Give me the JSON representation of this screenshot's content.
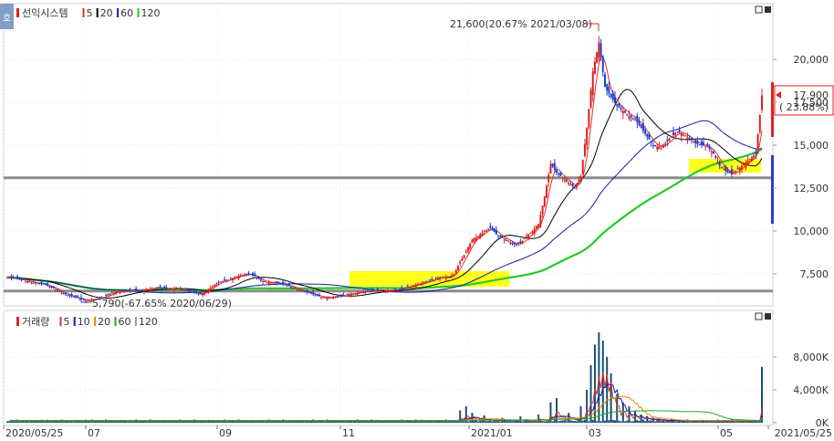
{
  "header": {
    "side_badge": "호",
    "price_title": "선익시스템",
    "price_ma": [
      {
        "label": "5",
        "color": "#e03030"
      },
      {
        "label": "20",
        "color": "#000000"
      },
      {
        "label": "60",
        "color": "#1a1aa8"
      },
      {
        "label": "120",
        "color": "#22cc22"
      }
    ],
    "volume_title": "거래량",
    "volume_ma": [
      {
        "label": "5",
        "color": "#e03030"
      },
      {
        "label": "10",
        "color": "#1a1aa8"
      },
      {
        "label": "20",
        "color": "#e08a00"
      },
      {
        "label": "60",
        "color": "#22aa22"
      },
      {
        "label": "120",
        "color": "#999999"
      }
    ]
  },
  "chart_data": {
    "type": "candlestick",
    "x_ticks": [
      "2020/05/25",
      "07",
      "09",
      "11",
      "2021/01",
      "03",
      "05",
      "2021/05/25"
    ],
    "price_axis": {
      "ticks": [
        "20,000",
        "17,500",
        "15,000",
        "12,500",
        "10,000",
        "7,500"
      ],
      "range": [
        5900,
        22400
      ]
    },
    "volume_axis": {
      "ticks": [
        "8,000K",
        "4,000K",
        "0K"
      ],
      "range": [
        0,
        12000
      ]
    },
    "annotations": {
      "high": "21,600(20.67% 2021/03/08)",
      "low": "5,790(-67.65% 2020/06/29)",
      "current_price": "17,900",
      "current_change": "( 23.88%)"
    },
    "horizontal_lines": [
      13100,
      6500
    ],
    "colors": {
      "up": "#e02020",
      "down": "#1f3fd0",
      "ma5": "#e03030",
      "ma20": "#000000",
      "ma60": "#1a1aa8",
      "ma120": "#22cc22",
      "highlight": "#ffff00",
      "volume": "#1b4f72"
    },
    "price_points": [
      [
        0,
        7300
      ],
      [
        3,
        7250
      ],
      [
        6,
        7200
      ],
      [
        9,
        7100
      ],
      [
        12,
        7000
      ],
      [
        15,
        6950
      ],
      [
        18,
        6900
      ],
      [
        21,
        6750
      ],
      [
        24,
        6600
      ],
      [
        27,
        6400
      ],
      [
        30,
        6250
      ],
      [
        33,
        6150
      ],
      [
        36,
        6050
      ],
      [
        39,
        5950
      ],
      [
        42,
        6000
      ],
      [
        45,
        6050
      ],
      [
        48,
        6150
      ],
      [
        51,
        6350
      ],
      [
        54,
        6450
      ],
      [
        57,
        6500
      ],
      [
        60,
        6500
      ],
      [
        63,
        6550
      ],
      [
        66,
        6500
      ],
      [
        69,
        6600
      ],
      [
        72,
        6650
      ],
      [
        75,
        6700
      ],
      [
        78,
        6650
      ],
      [
        81,
        6600
      ],
      [
        84,
        6700
      ],
      [
        87,
        6600
      ],
      [
        90,
        6500
      ],
      [
        93,
        6400
      ],
      [
        96,
        6300
      ],
      [
        99,
        6500
      ],
      [
        102,
        6800
      ],
      [
        105,
        7000
      ],
      [
        108,
        7100
      ],
      [
        111,
        7200
      ],
      [
        114,
        7350
      ],
      [
        117,
        7450
      ],
      [
        120,
        7500
      ],
      [
        123,
        7350
      ],
      [
        126,
        7100
      ],
      [
        129,
        7000
      ],
      [
        132,
        7000
      ],
      [
        135,
        6950
      ],
      [
        138,
        6850
      ],
      [
        141,
        6750
      ],
      [
        144,
        6600
      ],
      [
        147,
        6500
      ],
      [
        150,
        6400
      ],
      [
        153,
        6250
      ],
      [
        156,
        6150
      ],
      [
        159,
        6100
      ],
      [
        162,
        6150
      ],
      [
        165,
        6200
      ],
      [
        168,
        6250
      ],
      [
        171,
        6350
      ],
      [
        174,
        6400
      ],
      [
        177,
        6450
      ],
      [
        180,
        6500
      ],
      [
        183,
        6550
      ],
      [
        186,
        6550
      ],
      [
        189,
        6500
      ],
      [
        192,
        6550
      ],
      [
        195,
        6600
      ],
      [
        198,
        6700
      ],
      [
        201,
        6800
      ],
      [
        204,
        6900
      ],
      [
        207,
        7000
      ],
      [
        210,
        7100
      ],
      [
        213,
        7200
      ],
      [
        216,
        7350
      ],
      [
        219,
        7300
      ],
      [
        222,
        7500
      ],
      [
        225,
        8200
      ],
      [
        228,
        8800
      ],
      [
        231,
        9500
      ],
      [
        234,
        9700
      ],
      [
        237,
        10000
      ],
      [
        240,
        10200
      ],
      [
        243,
        9800
      ],
      [
        246,
        9600
      ],
      [
        249,
        9400
      ],
      [
        252,
        9200
      ],
      [
        255,
        9300
      ],
      [
        258,
        9700
      ],
      [
        261,
        10000
      ],
      [
        264,
        10400
      ],
      [
        267,
        12000
      ],
      [
        270,
        13900
      ],
      [
        273,
        13400
      ],
      [
        276,
        13100
      ],
      [
        279,
        12800
      ],
      [
        282,
        12500
      ],
      [
        285,
        13200
      ],
      [
        288,
        16000
      ],
      [
        291,
        19300
      ],
      [
        294,
        21000
      ],
      [
        297,
        18400
      ],
      [
        300,
        17800
      ],
      [
        303,
        17300
      ],
      [
        306,
        17000
      ],
      [
        309,
        16700
      ],
      [
        312,
        16500
      ],
      [
        315,
        16000
      ],
      [
        318,
        15500
      ],
      [
        321,
        15000
      ],
      [
        324,
        14900
      ],
      [
        327,
        15100
      ],
      [
        330,
        15500
      ],
      [
        333,
        15800
      ],
      [
        336,
        15600
      ],
      [
        339,
        15400
      ],
      [
        342,
        15100
      ],
      [
        345,
        15000
      ],
      [
        348,
        14900
      ],
      [
        351,
        14500
      ],
      [
        354,
        13800
      ],
      [
        357,
        13500
      ],
      [
        360,
        13300
      ],
      [
        363,
        13600
      ],
      [
        366,
        13900
      ],
      [
        369,
        14200
      ],
      [
        372,
        14500
      ],
      [
        375,
        17900
      ]
    ],
    "volume_spikes": [
      [
        225,
        1500
      ],
      [
        228,
        2000
      ],
      [
        231,
        1200
      ],
      [
        237,
        900
      ],
      [
        246,
        600
      ],
      [
        255,
        800
      ],
      [
        264,
        1000
      ],
      [
        270,
        2500
      ],
      [
        273,
        3000
      ],
      [
        279,
        1200
      ],
      [
        285,
        2000
      ],
      [
        288,
        4000
      ],
      [
        290,
        7000
      ],
      [
        292,
        9500
      ],
      [
        294,
        11000
      ],
      [
        296,
        10000
      ],
      [
        298,
        8000
      ],
      [
        300,
        6000
      ],
      [
        303,
        3500
      ],
      [
        306,
        2500
      ],
      [
        309,
        2000
      ],
      [
        312,
        1500
      ],
      [
        315,
        1000
      ],
      [
        318,
        800
      ],
      [
        321,
        600
      ],
      [
        330,
        500
      ],
      [
        375,
        6800
      ],
      [
        376,
        4200
      ]
    ]
  }
}
